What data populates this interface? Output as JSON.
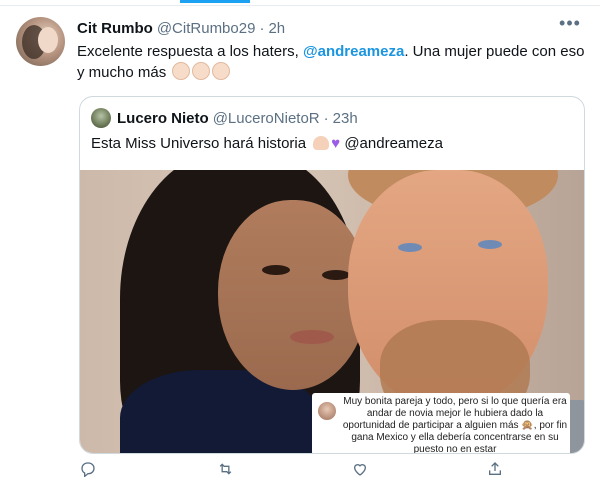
{
  "tweet": {
    "author_name": "Cit Rumbo",
    "author_handle": "@CitRumbo29",
    "separator": "·",
    "time": "2h",
    "more_label": "•••",
    "text_before": "Excelente respuesta a los haters, ",
    "mention": "@andreameza",
    "text_after": ". Una mujer puede con eso y mucho más"
  },
  "quote": {
    "author_name": "Lucero Nieto",
    "author_handle": "@LuceroNietoR",
    "separator": "·",
    "time": "23h",
    "text": "Esta Miss Universo hará historia",
    "text_mention": "@andreameza",
    "comment_text": "Muy bonita pareja y todo, pero si lo que quería era andar de novia mejor le hubiera dado la oportunidad de participar a alguien más 🙊, por fin gana Mexico y ella debería concentrarse en su puesto no en estar"
  },
  "actions": {
    "reply_icon": "reply-icon",
    "retweet_icon": "retweet-icon",
    "like_icon": "like-icon",
    "share_icon": "share-icon"
  },
  "colors": {
    "accent": "#1da1f2",
    "mention": "#1b95e0",
    "secondary_text": "#5b7083"
  }
}
